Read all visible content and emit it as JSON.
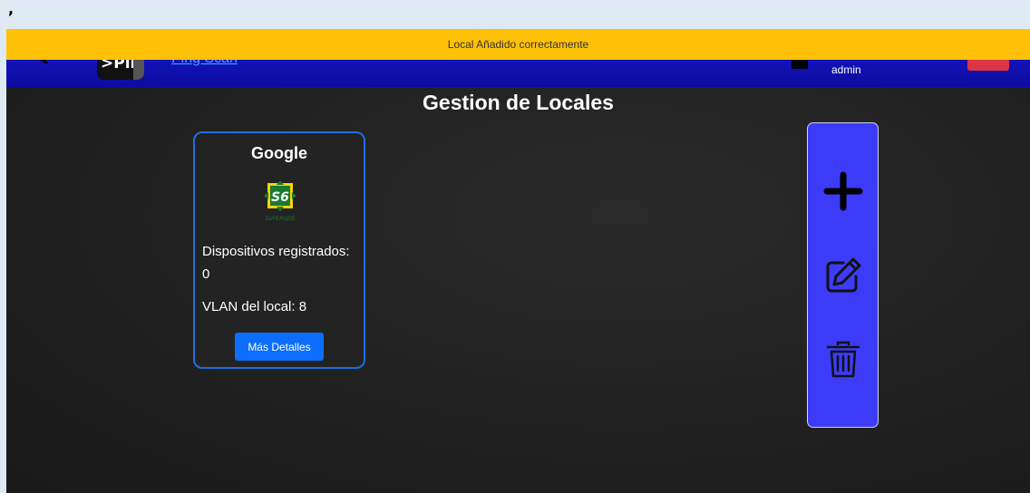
{
  "stray_mark": ",",
  "toast": {
    "message": "Local Añadido correctamente"
  },
  "navbar": {
    "logo_text": ">Ping",
    "link_text": "Ping Scan",
    "username": "admin"
  },
  "page": {
    "title": "Gestion de Locales"
  },
  "locales": [
    {
      "name": "Google",
      "logo_text": "S6",
      "logo_caption": "SUPERSEIS",
      "devices_label": "Dispositivos registrados: 0",
      "vlan_label": "VLAN del local: 8",
      "details_button": "Más Detalles"
    }
  ],
  "actions": {
    "add_icon": "plus-icon",
    "edit_icon": "edit-icon",
    "delete_icon": "trash-icon"
  },
  "colors": {
    "navbar": "#1a19d6",
    "toast": "#ffc107",
    "card_border": "#1f6fe0",
    "primary_button": "#0d6efd",
    "action_panel": "#3c3cf8",
    "logout": "#dc3545"
  }
}
